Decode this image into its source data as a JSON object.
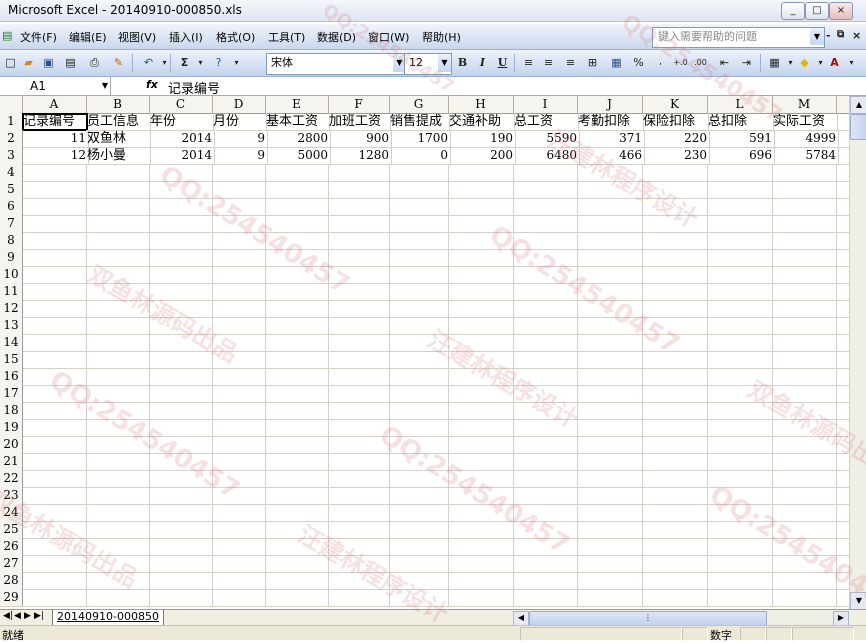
{
  "window": {
    "title": "Microsoft Excel - 20140910-000850.xls",
    "controls": [
      "_",
      "□",
      "×"
    ]
  },
  "menu": {
    "items": [
      "文件(F)",
      "编辑(E)",
      "视图(V)",
      "插入(I)",
      "格式(O)",
      "工具(T)",
      "数据(D)",
      "窗口(W)",
      "帮助(H)"
    ],
    "help_placeholder": "键入需要帮助的问题",
    "mdi_controls": [
      "-",
      "♂",
      "×"
    ]
  },
  "toolbar": {
    "font_name": "宋体",
    "font_size": "12",
    "bold": "B",
    "italic": "I",
    "underline": "U",
    "percent": "%",
    "sigma": "Σ"
  },
  "formula_bar": {
    "name_box": "A1",
    "fx": "fx",
    "content": "记录编号"
  },
  "sheet": {
    "columns": [
      "A",
      "B",
      "C",
      "D",
      "E",
      "F",
      "G",
      "H",
      "I",
      "J",
      "K",
      "L",
      "M"
    ],
    "row_numbers": [
      "1",
      "2",
      "3",
      "4",
      "5",
      "6",
      "7",
      "8",
      "9",
      "10",
      "11",
      "12",
      "13",
      "14",
      "15",
      "16",
      "17",
      "18",
      "19",
      "20",
      "21",
      "22",
      "23",
      "24",
      "25",
      "26",
      "27",
      "28",
      "29"
    ],
    "header_row": [
      "记录编号",
      "员工信息",
      "年份",
      "月份",
      "基本工资",
      "加班工资",
      "销售提成",
      "交通补助",
      "总工资",
      "考勤扣除",
      "保险扣除",
      "总扣除",
      "实际工资"
    ],
    "data_rows": [
      [
        "11",
        "双鱼林",
        "2014",
        "9",
        "2800",
        "900",
        "1700",
        "190",
        "5590",
        "371",
        "220",
        "591",
        "4999"
      ],
      [
        "12",
        "杨小曼",
        "2014",
        "9",
        "5000",
        "1280",
        "0",
        "200",
        "6480",
        "466",
        "230",
        "696",
        "5784"
      ]
    ],
    "tab_name": "20140910-000850"
  },
  "status": {
    "ready": "就绪",
    "mode": "数字"
  },
  "watermark": {
    "qq": "QQ:254540457",
    "brand1": "双鱼林源码出品",
    "brand2": "汪建林程序设计"
  }
}
